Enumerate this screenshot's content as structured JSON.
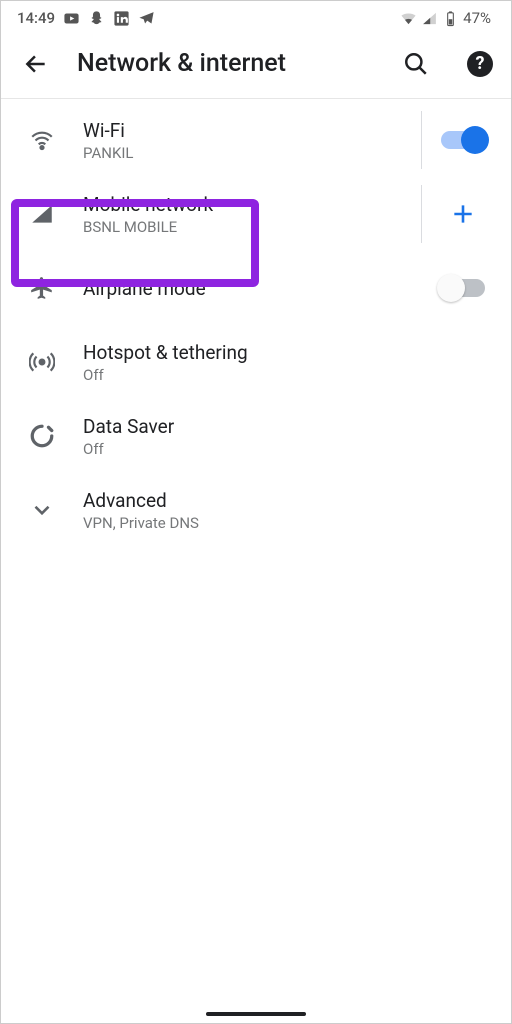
{
  "status": {
    "time": "14:49",
    "battery": "47%"
  },
  "header": {
    "title": "Network & internet"
  },
  "items": {
    "wifi": {
      "title": "Wi-Fi",
      "subtitle": "PANKIL"
    },
    "mobile": {
      "title": "Mobile network",
      "subtitle": "BSNL MOBILE"
    },
    "airplane": {
      "title": "Airplane mode"
    },
    "hotspot": {
      "title": "Hotspot & tethering",
      "subtitle": "Off"
    },
    "datasaver": {
      "title": "Data Saver",
      "subtitle": "Off"
    },
    "advanced": {
      "title": "Advanced",
      "subtitle": "VPN, Private DNS"
    }
  }
}
